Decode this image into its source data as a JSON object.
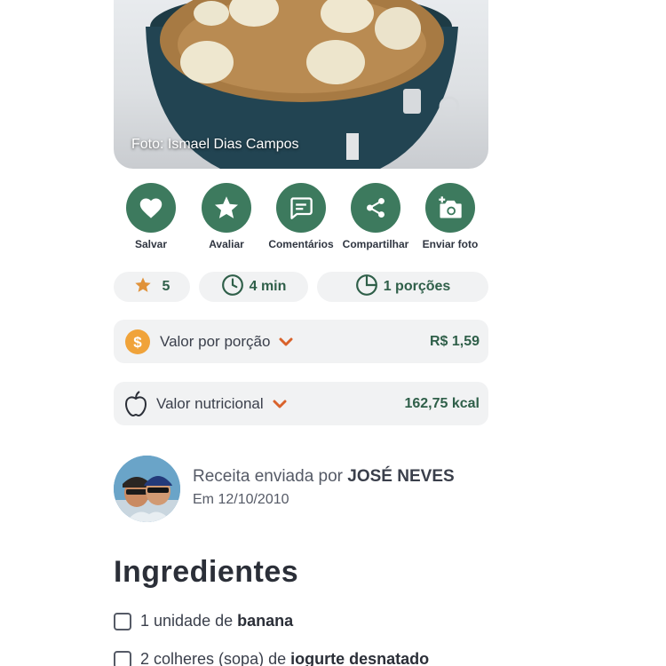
{
  "photo": {
    "credit": "Foto: Ismael Dias Campos"
  },
  "actions": [
    {
      "label": "Salvar",
      "icon": "heart-icon"
    },
    {
      "label": "Avaliar",
      "icon": "star-icon"
    },
    {
      "label": "Comentários",
      "icon": "comment-icon"
    },
    {
      "label": "Compartilhar",
      "icon": "share-icon"
    },
    {
      "label": "Enviar foto",
      "icon": "add-photo-icon"
    }
  ],
  "stats": {
    "rating": "5",
    "time": "4 min",
    "servings": "1 porções"
  },
  "cost": {
    "label": "Valor por porção",
    "value": "R$ 1,59",
    "icon": "coin-icon"
  },
  "nutrition": {
    "label": "Valor nutricional",
    "value": "162,75 kcal",
    "icon": "apple-icon"
  },
  "author": {
    "prefix": "Receita enviada por ",
    "name": "JOSÉ NEVES",
    "date": "Em 12/10/2010"
  },
  "ingredients": {
    "title": "Ingredientes",
    "items": [
      {
        "prefix": "1 unidade de ",
        "name": "banana"
      },
      {
        "prefix": "2 colheres (sopa) de ",
        "name": "iogurte desnatado"
      }
    ]
  },
  "colors": {
    "accent_green": "#3d7a5e",
    "value_green": "#2f5f49",
    "chevron_orange": "#d9622b",
    "coin_orange": "#f0a33a",
    "pill_bg": "#f1f2f3"
  }
}
